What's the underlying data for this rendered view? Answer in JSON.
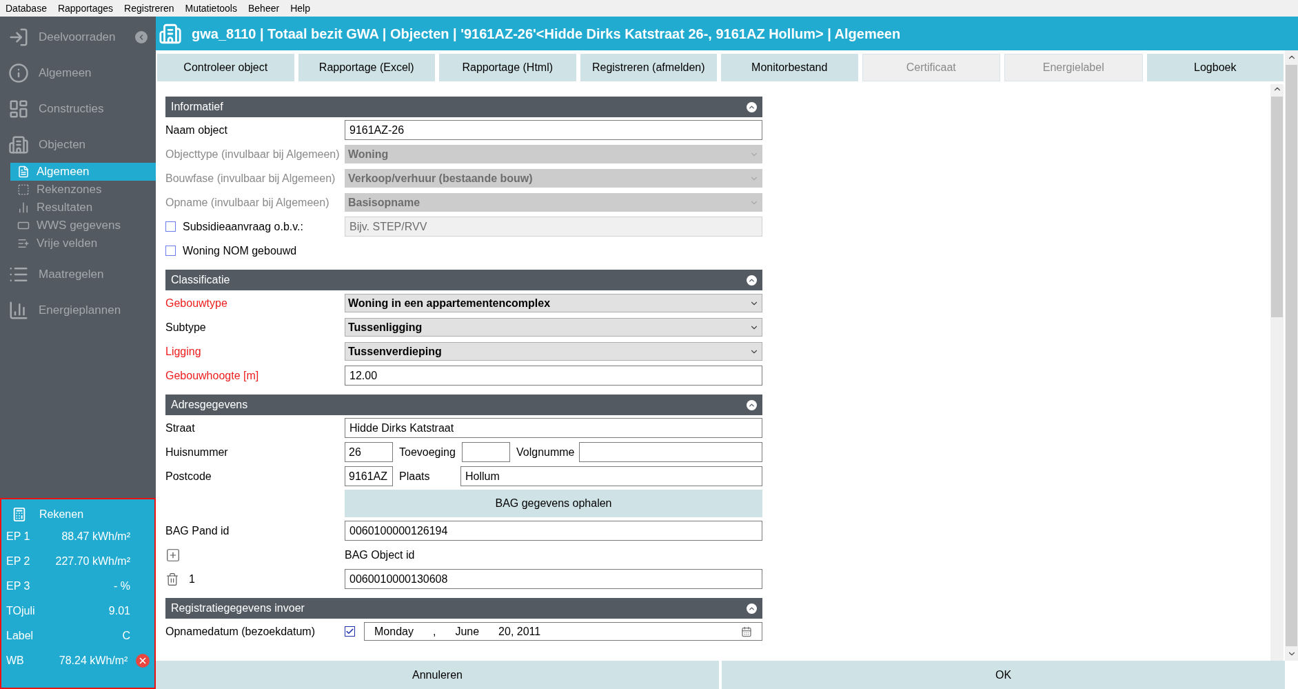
{
  "menu": [
    "Database",
    "Rapportages",
    "Registreren",
    "Mutatietools",
    "Beheer",
    "Help"
  ],
  "sidebar": {
    "items": [
      {
        "label": "Deelvoorraden",
        "selected": false
      },
      {
        "label": "Algemeen",
        "selected": false
      },
      {
        "label": "Constructies",
        "selected": false
      },
      {
        "label": "Objecten",
        "selected": false,
        "children": [
          {
            "label": "Algemeen",
            "selected": true
          },
          {
            "label": "Rekenzones",
            "selected": false
          },
          {
            "label": "Resultaten",
            "selected": false
          },
          {
            "label": "WWS gegevens",
            "selected": false
          },
          {
            "label": "Vrije velden",
            "selected": false
          }
        ]
      },
      {
        "label": "Maatregelen",
        "selected": false
      },
      {
        "label": "Energieplannen",
        "selected": false
      }
    ]
  },
  "rekenen": {
    "title": "Rekenen",
    "rows": [
      {
        "label": "EP 1",
        "value": "88.47 kWh/m²",
        "error": false
      },
      {
        "label": "EP 2",
        "value": "227.70 kWh/m²",
        "error": false
      },
      {
        "label": "EP 3",
        "value": "-  %",
        "error": false
      },
      {
        "label": "TOjuli",
        "value": "9.01",
        "error": false
      },
      {
        "label": "Label",
        "value": "C",
        "error": false
      },
      {
        "label": "WB",
        "value": "78.24 kWh/m²",
        "error": true
      }
    ]
  },
  "header": {
    "title": "gwa_8110 | Totaal bezit GWA | Objecten | '9161AZ-26'<Hidde Dirks Katstraat 26-, 9161AZ Hollum> | Algemeen"
  },
  "toolbar": [
    {
      "label": "Controleer object",
      "disabled": false
    },
    {
      "label": "Rapportage (Excel)",
      "disabled": false
    },
    {
      "label": "Rapportage (Html)",
      "disabled": false
    },
    {
      "label": "Registreren (afmelden)",
      "disabled": false
    },
    {
      "label": "Monitorbestand",
      "disabled": false
    },
    {
      "label": "Certificaat",
      "disabled": true
    },
    {
      "label": "Energielabel",
      "disabled": true
    },
    {
      "label": "Logboek",
      "disabled": false
    }
  ],
  "sections": [
    {
      "title": "Informatief",
      "expanded": true,
      "rows": [
        {
          "kind": "text",
          "label": "Naam object",
          "value": "9161AZ-26",
          "disabled": false,
          "required": false
        },
        {
          "kind": "select",
          "label": "Objecttype (invulbaar bij Algemeen)",
          "value": "Woning",
          "disabled": true
        },
        {
          "kind": "select",
          "label": "Bouwfase (invulbaar bij Algemeen)",
          "value": "Verkoop/verhuur (bestaande bouw)",
          "disabled": true
        },
        {
          "kind": "select",
          "label": "Opname (invulbaar bij Algemeen)",
          "value": "Basisopname",
          "disabled": true
        },
        {
          "kind": "checkfield",
          "label": "Subsidieaanvraag o.b.v.:",
          "checked": false,
          "placeholder": "Bijv. STEP/RVV"
        },
        {
          "kind": "check",
          "label": "Woning NOM gebouwd",
          "checked": false
        }
      ]
    },
    {
      "title": "Classificatie",
      "expanded": true,
      "rows": [
        {
          "kind": "select",
          "label": "Gebouwtype",
          "value": "Woning in een appartementencomplex",
          "disabled": false,
          "required": true
        },
        {
          "kind": "select",
          "label": "Subtype",
          "value": "Tussenligging",
          "disabled": false,
          "required": false
        },
        {
          "kind": "select",
          "label": "Ligging",
          "value": "Tussenverdieping",
          "disabled": false,
          "required": true
        },
        {
          "kind": "text",
          "label": "Gebouwhoogte [m]",
          "value": "12.00",
          "disabled": false,
          "required": true
        }
      ]
    },
    {
      "title": "Adresgegevens",
      "expanded": true,
      "rows": [
        {
          "kind": "text",
          "label": "Straat",
          "value": "Hidde Dirks Katstraat",
          "disabled": false,
          "required": false
        },
        {
          "kind": "multi",
          "label": "Huisnummer",
          "value": "26",
          "fields": [
            {
              "label": "Toevoeging"
            },
            {
              "label": "Volgnumme"
            }
          ]
        },
        {
          "kind": "multi",
          "label": "Postcode",
          "value": "9161AZ",
          "fields": [
            {
              "label": "Plaats",
              "value": "Hollum"
            }
          ]
        },
        {
          "kind": "button",
          "label": "BAG gegevens ophalen"
        },
        {
          "kind": "text",
          "label": "BAG Pand id",
          "value": "0060100000126194",
          "disabled": false,
          "required": false
        },
        {
          "kind": "add",
          "label": "BAG Object id"
        },
        {
          "kind": "indexed",
          "index": "1",
          "value": "0060010000130608"
        }
      ]
    },
    {
      "title": "Registratiegegevens invoer",
      "expanded": true,
      "rows": [
        {
          "kind": "date",
          "label": "Opnamedatum (bezoekdatum)",
          "checked": true,
          "parts": [
            "Monday",
            ",",
            "June",
            "20, 2011"
          ]
        }
      ]
    }
  ],
  "footer": [
    "Annuleren",
    "OK"
  ]
}
